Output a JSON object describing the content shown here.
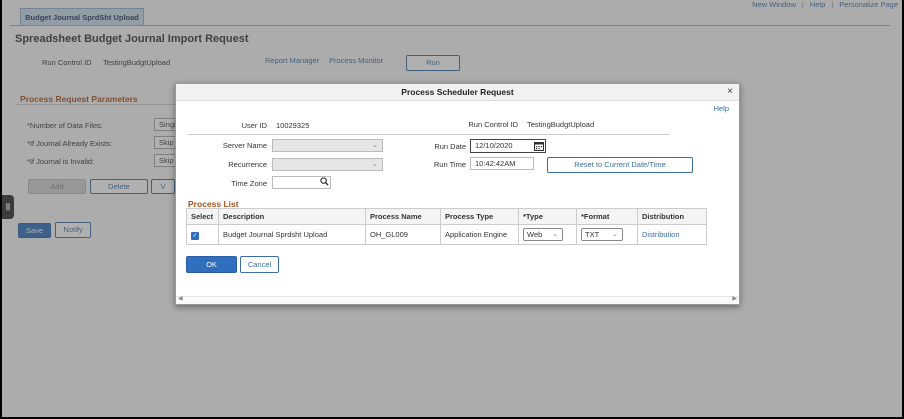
{
  "background": {
    "tab_label": "Budget Journal SprdSht Upload",
    "top_links": [
      "New Window",
      "Help",
      "Personalize Page"
    ],
    "top_links_sep": "|",
    "page_title": "Spreadsheet Budget Journal Import Request",
    "run_control_label": "Run Control ID",
    "run_control_value": "TestingBudgtUpload",
    "report_manager": "Report Manager",
    "process_monitor": "Process Monitor",
    "run_button": "Run",
    "params_title": "Process Request Parameters",
    "params": [
      {
        "label": "*Number of Data Files:",
        "value": "Singl"
      },
      {
        "label": "*If Journal Already Exists:",
        "value": "Skip"
      },
      {
        "label": "*If Journal is Invalid:",
        "value": "Skip"
      }
    ],
    "add_button": "Add",
    "delete_button": "Delete",
    "view_button": "V",
    "save_button": "Save",
    "notify_button": "Notify"
  },
  "modal": {
    "title": "Process Scheduler Request",
    "close": "×",
    "help": "Help",
    "user_id_label": "User ID",
    "user_id_value": "10029325",
    "run_control_label": "Run Control ID",
    "run_control_value": "TestingBudgtUpload",
    "server_name_label": "Server Name",
    "server_name_value": "",
    "recurrence_label": "Recurrence",
    "recurrence_value": "",
    "time_zone_label": "Time Zone",
    "time_zone_value": "",
    "run_date_label": "Run Date",
    "run_date_value": "12/10/2020",
    "run_time_label": "Run Time",
    "run_time_value": "10:42:42AM",
    "reset_button": "Reset to Current Date/Time",
    "process_list_title": "Process List",
    "columns": [
      "Select",
      "Description",
      "Process Name",
      "Process Type",
      "*Type",
      "*Format",
      "Distribution"
    ],
    "rows": [
      {
        "selected": true,
        "description": "Budget Journal Sprdsht Upload",
        "process_name": "OH_GL009",
        "process_type": "Application Engine",
        "type": "Web",
        "format": "TXT",
        "distribution": "Distribution"
      }
    ],
    "ok_button": "OK",
    "cancel_button": "Cancel"
  },
  "icons": {
    "calendar": "calendar-icon",
    "search": "search-icon",
    "chevron": "chevron-down-icon",
    "checkmark": "✓"
  }
}
